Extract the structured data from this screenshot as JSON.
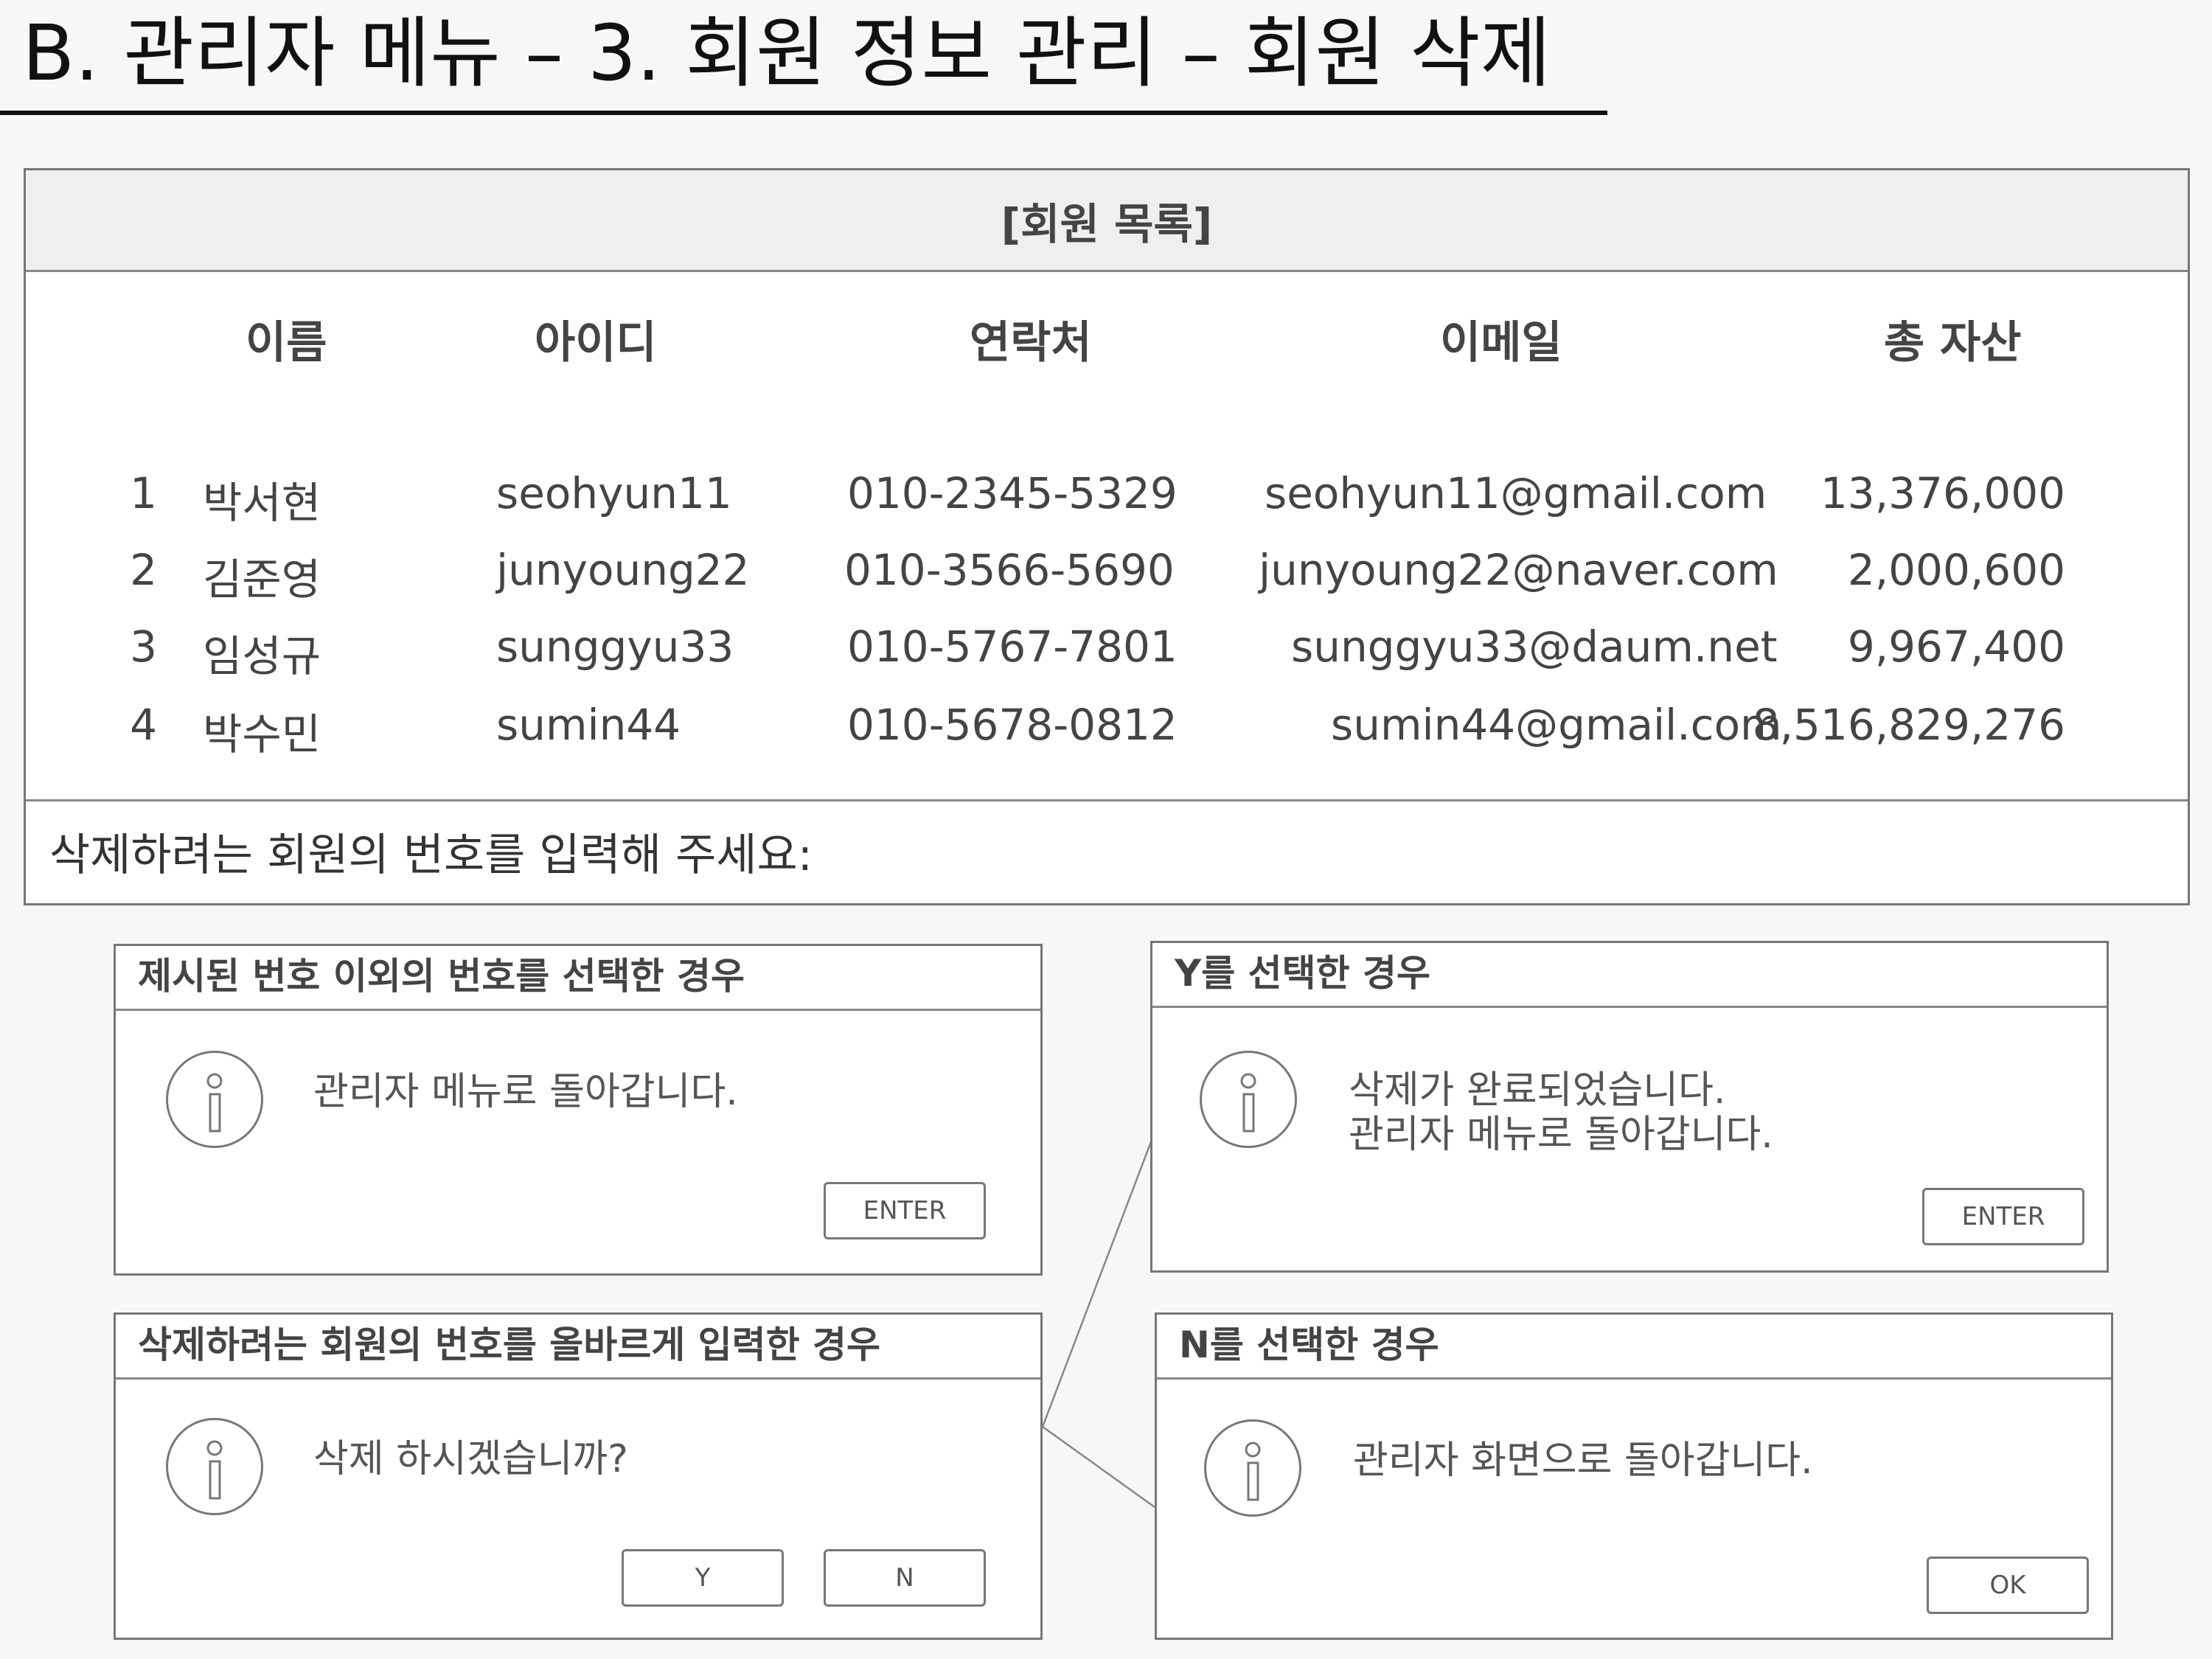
{
  "page": {
    "title": "B. 관리자 메뉴 – 3. 회원 정보 관리 – 회원 삭제"
  },
  "member_list": {
    "header": "[회원 목록]",
    "columns": [
      "이름",
      "아이디",
      "연락처",
      "이메일",
      "총 자산"
    ],
    "rows": [
      {
        "no": "1",
        "name": "박서현",
        "id": "seohyun11",
        "phone": "010-2345-5329",
        "email": "seohyun11@gmail.com",
        "assets": "13,376,000"
      },
      {
        "no": "2",
        "name": "김준영",
        "id": "junyoung22",
        "phone": "010-3566-5690",
        "email": "junyoung22@naver.com",
        "assets": "2,000,600"
      },
      {
        "no": "3",
        "name": "임성규",
        "id": "sunggyu33",
        "phone": "010-5767-7801",
        "email": "sunggyu33@daum.net",
        "assets": "9,967,400"
      },
      {
        "no": "4",
        "name": "박수민",
        "id": "sumin44",
        "phone": "010-5678-0812",
        "email": "sumin44@gmail.com",
        "assets": "8,516,829,276"
      }
    ],
    "prompt": "삭제하려는 회원의 번호를 입력해 주세요:"
  },
  "dialogs": {
    "invalid_number": {
      "title": "제시된 번호 이외의 번호를 선택한 경우",
      "message": "관리자 메뉴로 돌아갑니다.",
      "button": "ENTER"
    },
    "select_y": {
      "title": "Y를 선택한 경우",
      "message_line1": "삭제가 완료되었습니다.",
      "message_line2": "관리자 메뉴로 돌아갑니다.",
      "button": "ENTER"
    },
    "valid_number": {
      "title": "삭제하려는 회원의 번호를 올바르게 입력한 경우",
      "message": "삭제 하시겠습니까?",
      "button_yes": "Y",
      "button_no": "N"
    },
    "select_n": {
      "title": "N를 선택한 경우",
      "message": "관리자 화면으로 돌아갑니다.",
      "button": "OK"
    }
  },
  "icons": {
    "dialog_icon": "info-circle-icon"
  },
  "colors": {
    "background": "#f7f7f7",
    "border": "#777777",
    "header_fill": "#efefef",
    "text": "#444444"
  }
}
